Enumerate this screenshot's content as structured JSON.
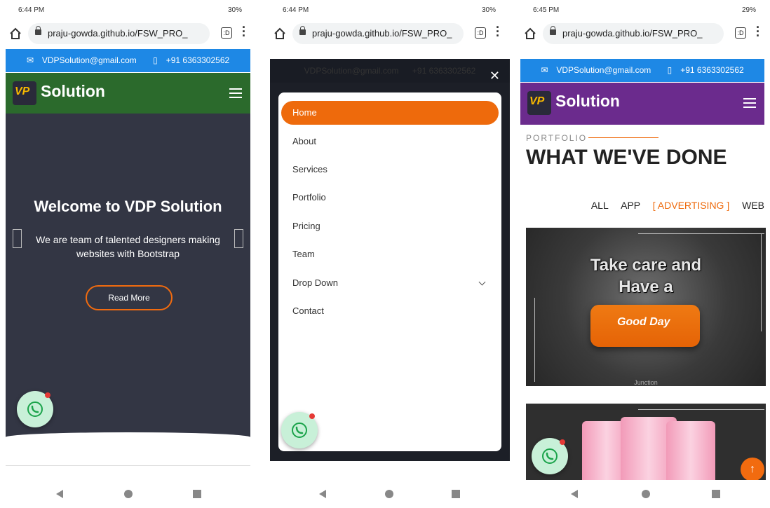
{
  "panels": [
    {
      "status": {
        "time": "6:44 PM",
        "battery": "30%"
      },
      "url": "praju-gowda.github.io/FSW_PRO_",
      "topbar": {
        "email": "VDPSolution@gmail.com",
        "phone": "+91 6363302562"
      },
      "brand": "Solution",
      "hero": {
        "title": "Welcome to VDP Solution",
        "text": "We are team of talented designers making websites with Bootstrap",
        "button": "Read More"
      }
    },
    {
      "status": {
        "time": "6:44 PM",
        "battery": "30%"
      },
      "url": "praju-gowda.github.io/FSW_PRO_",
      "topbar": {
        "email": "VDPSolution@gmail.com",
        "phone": "+91 6363302562"
      },
      "menu": {
        "items": [
          "Home",
          "About",
          "Services",
          "Portfolio",
          "Pricing",
          "Team",
          "Drop Down",
          "Contact"
        ],
        "active": "Home"
      }
    },
    {
      "status": {
        "time": "6:45 PM",
        "battery": "29%"
      },
      "url": "praju-gowda.github.io/FSW_PRO_",
      "topbar": {
        "email": "VDPSolution@gmail.com",
        "phone": "+91 6363302562"
      },
      "brand": "Solution",
      "portfolio": {
        "kicker": "PORTFOLIO",
        "title": "WHAT WE'VE DONE",
        "filters": [
          "ALL",
          "APP",
          "[ ADVERTISING ]",
          "WEB"
        ],
        "active_filter": "[ ADVERTISING ]",
        "cards": [
          {
            "caption_line1": "Take care and",
            "caption_line2": "Have a",
            "product_text": "Good Day",
            "footer": "Junction"
          }
        ]
      }
    }
  ],
  "colors": {
    "topbar": "#1e88e5",
    "header_p1": "#2b6a2c",
    "header_p3": "#6b2b8d",
    "accent": "#ee6a0c",
    "hero_bg": "#333644"
  },
  "icons": [
    "home-icon",
    "lock-icon",
    "tabs-icon",
    "menu-dots-icon",
    "mail-icon",
    "phone-icon",
    "hamburger-icon",
    "close-icon",
    "whatsapp-icon",
    "arrow-up-icon",
    "chevron-down-icon",
    "back-icon",
    "home-nav-icon",
    "recents-icon"
  ]
}
